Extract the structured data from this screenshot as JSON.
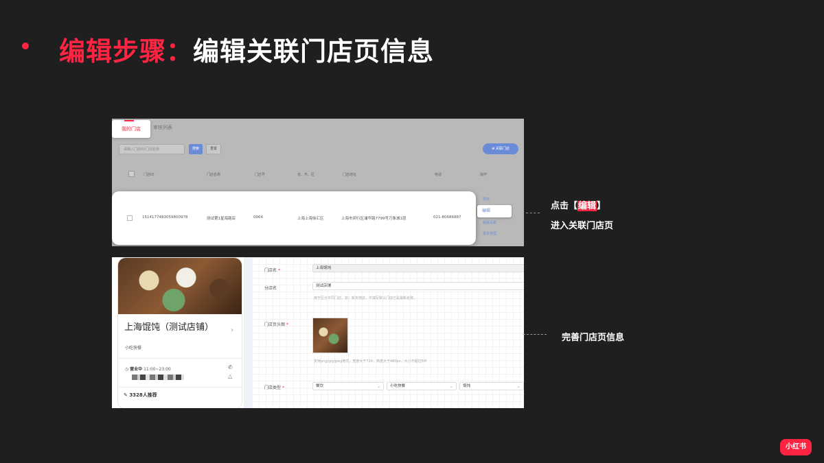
{
  "header": {
    "title_red": "编辑步骤：",
    "title_white": "编辑关联门店页信息"
  },
  "top_shot": {
    "tab_active": "我的门店",
    "tab_other": "审核列表",
    "search_placeholder": "请输入门店ID/门店名称",
    "search_button": "搜索",
    "reset_button": "重置",
    "link_button": "⊕ 关联门店",
    "columns": [
      "门店ID",
      "门店名称",
      "门店号",
      "省、市、区",
      "门店地址",
      "电话",
      "操作"
    ],
    "row": {
      "id": "1514177483059800978",
      "name": "测试第1星海路店",
      "no": "0064",
      "region": "上海上海徐汇区",
      "address": "上海市闵行区浦华路7799号万象城1层",
      "phone": "021-80686887"
    },
    "ops": [
      "预览",
      "编辑",
      "解除关联",
      "更多类型"
    ]
  },
  "annotations": {
    "a1_prefix": "点击【",
    "a1_highlight": "编辑",
    "a1_suffix": "】",
    "a1_line2": "进入关联门店页",
    "a2": "完善门店页信息"
  },
  "bottom_shot": {
    "store_name": "上海馄饨（测试店铺）",
    "category": "小吃快餐",
    "status": "营业中",
    "hours": "11:00~23:00",
    "recommend": "3328人推荐",
    "form": {
      "store_name_label": "门店名",
      "store_name_value": "上海馄饨",
      "branch_label": "分店名",
      "branch_value": "测试店铺",
      "branch_hint": "用于区分不同门店，如：新天地店，不填写默认门店已是最新名称。",
      "header_image_label": "门店页头图",
      "image_hint": "支持png/jpg/jpeg格式，宽度大于720，高度大于480px，大小不超过5M",
      "type_label": "门店类型",
      "type_values": [
        "餐饮",
        "小吃快餐",
        "馄饨"
      ]
    }
  },
  "logo": {
    "text": "小红书"
  },
  "colors": {
    "accent": "#ff2442",
    "background": "#1f1f20",
    "link": "#6a8cd8"
  }
}
